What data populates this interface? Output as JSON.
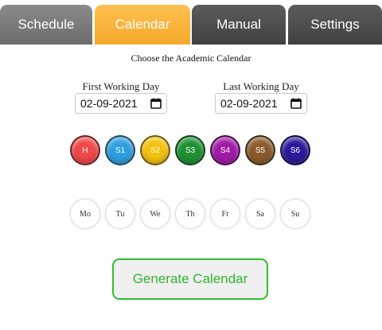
{
  "tabs": {
    "schedule": "Schedule",
    "calendar": "Calendar",
    "manual": "Manual",
    "settings": "Settings",
    "active": "Calendar",
    "active_color": "#f7b034"
  },
  "heading": "Choose the Academic Calendar",
  "first_day": {
    "label": "First Working Day",
    "value": "02-09-2021"
  },
  "last_day": {
    "label": "Last Working Day",
    "value": "02-09-2021"
  },
  "semesters": [
    {
      "label": "H",
      "color": "#f0474b"
    },
    {
      "label": "S1",
      "color": "#2d9fe0"
    },
    {
      "label": "S2",
      "color": "#f3c20d"
    },
    {
      "label": "S3",
      "color": "#1f8f34"
    },
    {
      "label": "S4",
      "color": "#a01aa8"
    },
    {
      "label": "S5",
      "color": "#8a5a2a"
    },
    {
      "label": "S6",
      "color": "#2a1a9a"
    }
  ],
  "days": [
    "Mo",
    "Tu",
    "We",
    "Th",
    "Fr",
    "Sa",
    "Su"
  ],
  "generate_label": "Generate Calendar",
  "generate_color": "#2fb52f"
}
